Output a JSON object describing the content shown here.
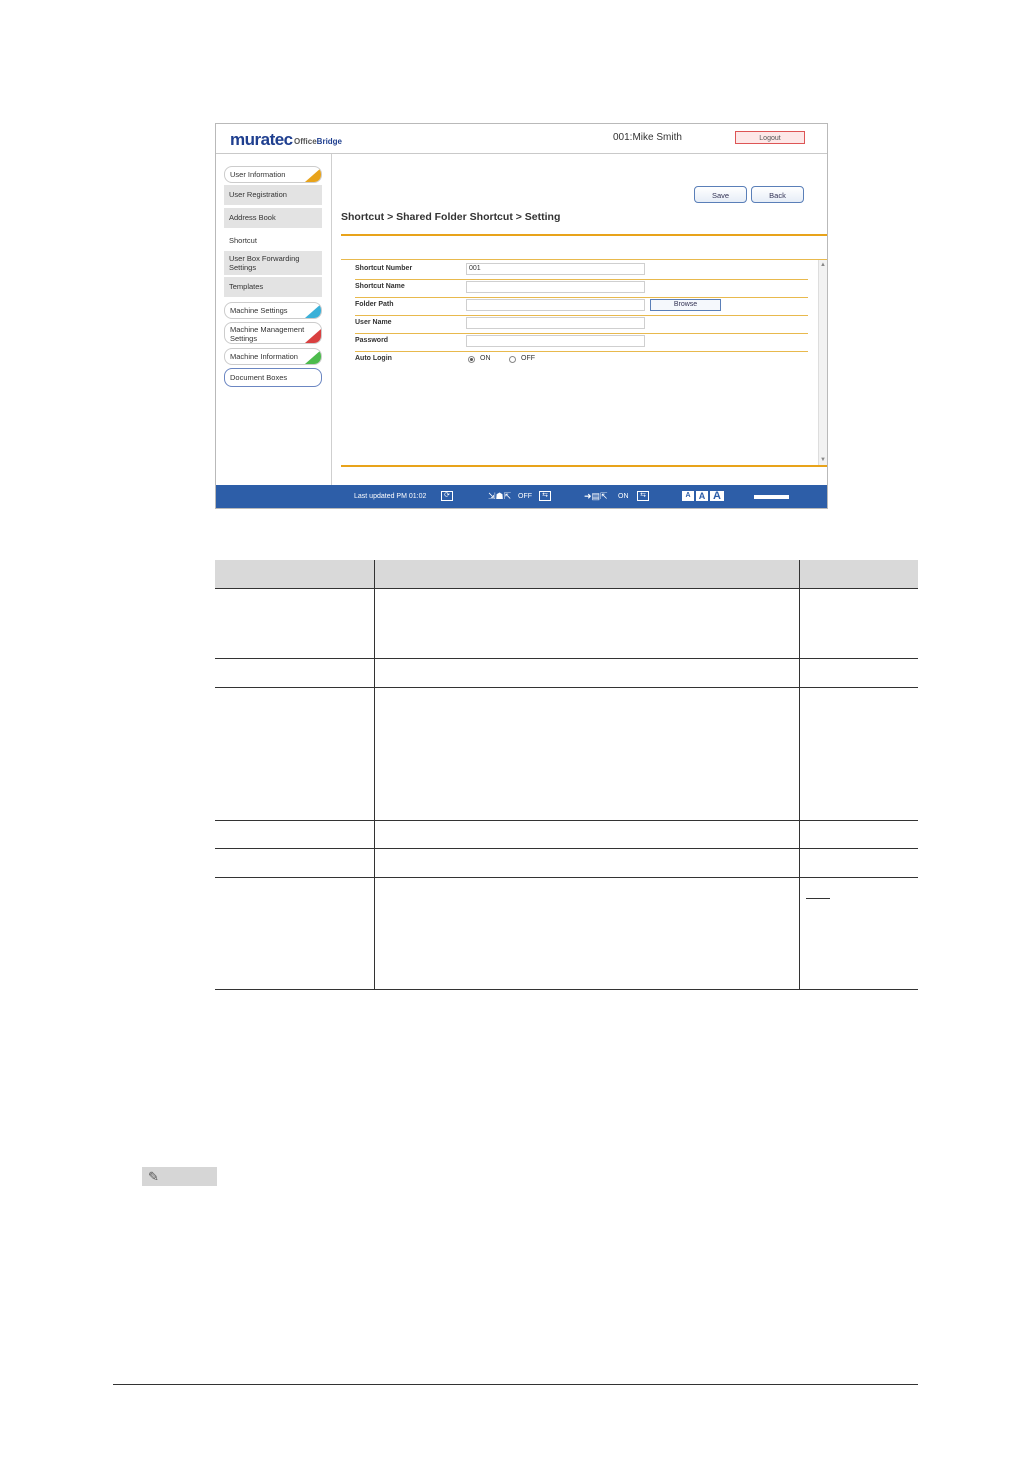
{
  "app": {
    "logo": "muratec",
    "logo_sub_a": "Office",
    "logo_sub_b": "Bridge",
    "user": "001:Mike Smith",
    "logout_label": "Logout"
  },
  "sidebar": {
    "items": [
      {
        "label": "User Information",
        "accent": "#e8a31a"
      },
      {
        "label": "User Registration"
      },
      {
        "label": "Address Book"
      },
      {
        "label": "Shortcut"
      },
      {
        "label": "User Box Forwarding Settings"
      },
      {
        "label": "Templates"
      },
      {
        "label": "Machine Settings",
        "accent": "#3ab0d8"
      },
      {
        "label": "Machine Management Settings",
        "accent": "#d94040"
      },
      {
        "label": "Machine Information",
        "accent": "#4cbb4c"
      },
      {
        "label": "Document Boxes"
      }
    ]
  },
  "toolbar": {
    "save_label": "Save",
    "back_label": "Back"
  },
  "breadcrumb": "Shortcut > Shared Folder Shortcut > Setting",
  "form": {
    "shortcut_number_label": "Shortcut Number",
    "shortcut_number_value": "001",
    "shortcut_name_label": "Shortcut Name",
    "shortcut_name_value": "",
    "folder_path_label": "Folder Path",
    "folder_path_value": "",
    "browse_label": "Browse",
    "user_name_label": "User Name",
    "user_name_value": "",
    "password_label": "Password",
    "password_value": "",
    "auto_login_label": "Auto Login",
    "auto_login_on": "ON",
    "auto_login_off": "OFF",
    "auto_login_selected": "ON"
  },
  "status": {
    "last_updated": "Last updated PM 01:02",
    "toggle1_state": "OFF",
    "toggle2_state": "ON",
    "font_a": "A"
  },
  "colors": {
    "accent_orange": "#e8a31a",
    "status_blue": "#2d5ea8"
  }
}
